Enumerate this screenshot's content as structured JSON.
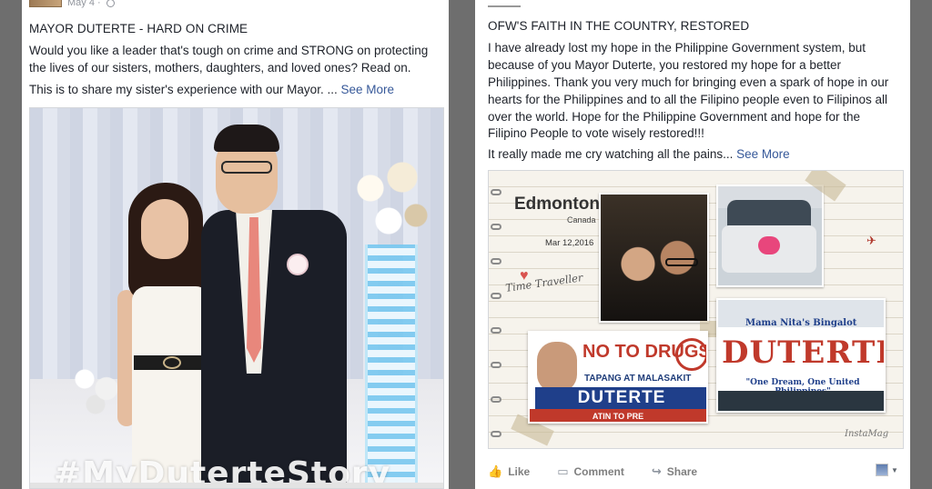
{
  "left_post": {
    "date": "May 4 ·",
    "title": "MAYOR DUTERTE - HARD ON CRIME",
    "body_line1": "Would you like a leader that's tough on crime and STRONG on protecting",
    "body_line2": "the lives of our sisters, mothers, daughters, and loved ones? Read on.",
    "body_line3": "This is to share my sister's experience with our Mayor. ...",
    "see_more": "See More",
    "photo_overlay_text": "#MyDuterteStory"
  },
  "right_post": {
    "title": "OFW'S FAITH IN THE COUNTRY, RESTORED",
    "body_lines": [
      "I have already lost my hope in the Philippine Government system, but",
      "because of you Mayor Duterte, you restored my hope for a better",
      "Philippines. Thank you very much for bringing even a spark of hope in our",
      "hearts for the Philippines and to all the Filipino people even to Filipinos all",
      "over the world. Hope for the Philippine Government and hope for the",
      "Filipino People to vote wisely restored!!!"
    ],
    "body_last": "It really made me cry watching all the pains...",
    "see_more": "See More",
    "collage": {
      "city": "Edmonton",
      "country": "Canada",
      "date": "Mar 12,2016",
      "caption": "Time Traveller",
      "no_to_drugs": "NO TO DRUGS",
      "sub_slogan": "TAPANG AT MALASAKIT",
      "candidate_name_blue": "DUTERTE",
      "atin_to": "ATIN TO PRE",
      "sign_label": "Mama Nita's Bingalot",
      "sign_name": "DUTERTE",
      "sign_motto": "\"One Dream, One United Philippines\"",
      "watermark": "InstaMag"
    },
    "actions": {
      "like": "Like",
      "comment": "Comment",
      "share": "Share"
    }
  },
  "colors": {
    "page_bg": "#6e6e6e",
    "link": "#365899",
    "text": "#1d2129",
    "action_text": "#7f7f7f"
  }
}
